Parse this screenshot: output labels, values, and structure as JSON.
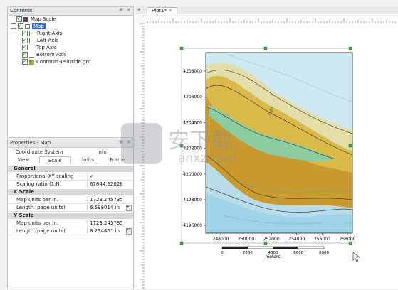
{
  "contents_panel": {
    "title": "Contents",
    "items": [
      {
        "label": "Map Scale"
      },
      {
        "label": "Map"
      },
      {
        "label": "Right Axis"
      },
      {
        "label": "Left Axis"
      },
      {
        "label": "Top Axis"
      },
      {
        "label": "Bottom Axis"
      },
      {
        "label": "Contours-Telluride.grd"
      }
    ]
  },
  "properties_panel": {
    "title": "Properties - Map",
    "tabs_row1": [
      "Coordinate System",
      "Info"
    ],
    "tabs_row2": [
      "View",
      "Scale",
      "Limits",
      "Frame"
    ],
    "active_tab": "Scale",
    "groups": {
      "general": {
        "header": "General",
        "rows": [
          {
            "key": "Proportional XY scaling",
            "value": "✓"
          },
          {
            "key": "Scaling ratio (1:N)",
            "value": "67844.32028"
          }
        ]
      },
      "x_scale": {
        "header": "X Scale",
        "rows": [
          {
            "key": "Map units per in.",
            "value": "1723.245735"
          },
          {
            "key": "Length (page units)",
            "value": "6.598014 in"
          }
        ]
      },
      "y_scale": {
        "header": "Y Scale",
        "rows": [
          {
            "key": "Map units per in.",
            "value": "1723.245735"
          },
          {
            "key": "Length (page units)",
            "value": "8.234461 in"
          }
        ]
      }
    }
  },
  "document": {
    "tab_label": "Plot1*"
  },
  "map": {
    "y_ticks": [
      "4208000",
      "4206000",
      "4204000",
      "4202000",
      "4200000",
      "4198000",
      "4196000"
    ],
    "x_ticks": [
      "248000",
      "250000",
      "252000",
      "254000",
      "256000",
      "258000"
    ],
    "scale_bar": {
      "labels": [
        "0",
        "2000",
        "4000",
        "6000",
        "8000"
      ],
      "unit": "meters"
    },
    "contour_label": "3100"
  },
  "watermark": {
    "text": "安下载",
    "sub": "anxz.com"
  },
  "colors": {
    "selection": "#2b6fcf",
    "low_elev": "#2f8fd0",
    "mid_elev": "#e8d98e",
    "high_elev": "#d4a020",
    "valley": "#7fc79a"
  }
}
